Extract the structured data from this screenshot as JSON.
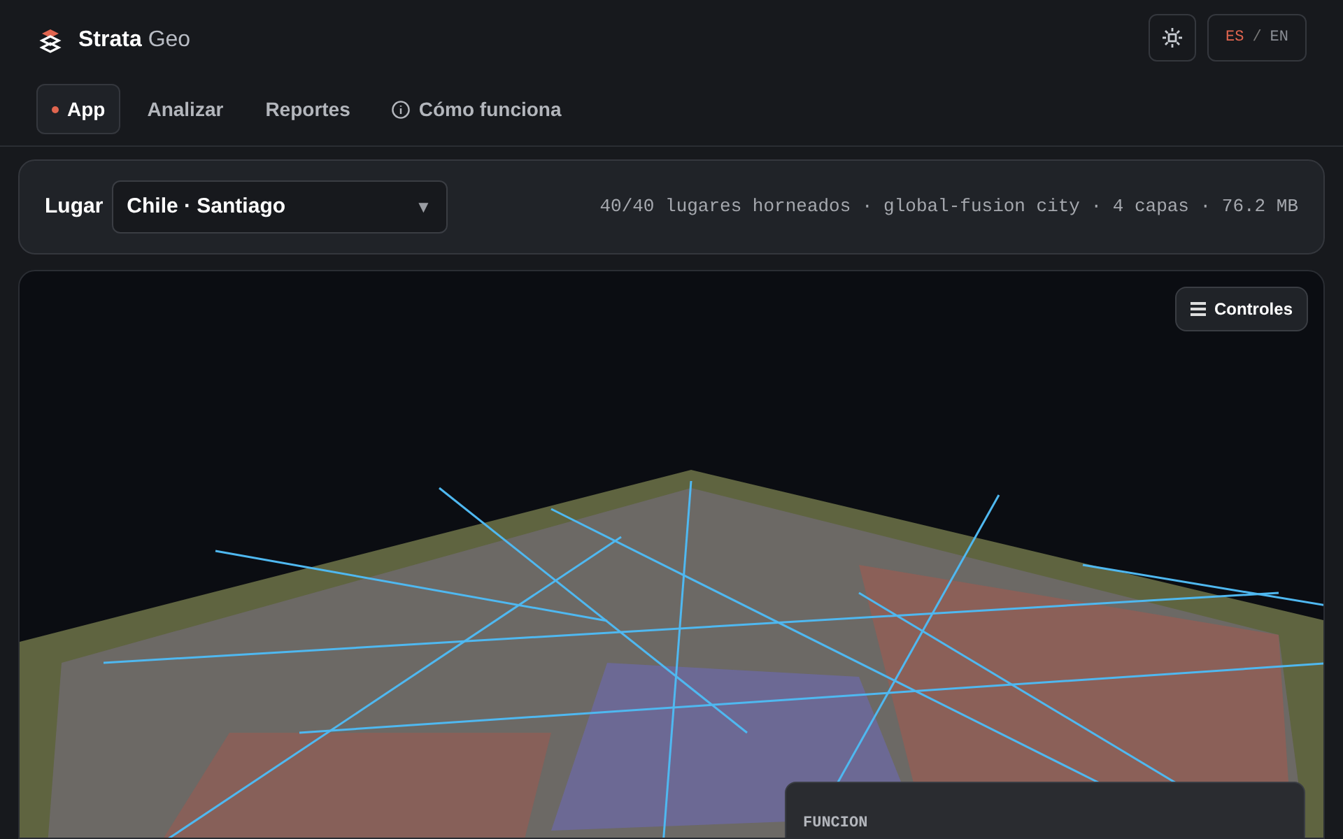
{
  "brand": {
    "name": "Strata",
    "suffix": "Geo"
  },
  "nav": [
    {
      "label": "App",
      "selected": true,
      "kind": "dot"
    },
    {
      "label": "Analizar",
      "selected": false,
      "kind": "plain"
    },
    {
      "label": "Reportes",
      "selected": false,
      "kind": "plain"
    },
    {
      "label": "Cómo funciona",
      "selected": false,
      "kind": "info"
    }
  ],
  "languages": [
    {
      "label": "ES",
      "selected": true
    },
    {
      "label": "EN",
      "selected": false
    }
  ],
  "language_separator": "/",
  "place": {
    "label": "Lugar",
    "value": "Chile · Santiago",
    "caret": "▼"
  },
  "stats": "40/40 lugares horneados · global-fusion city · 4 capas · 76.2 MB",
  "controls_button": "Controles",
  "legend": {
    "title": "FUNCION"
  }
}
